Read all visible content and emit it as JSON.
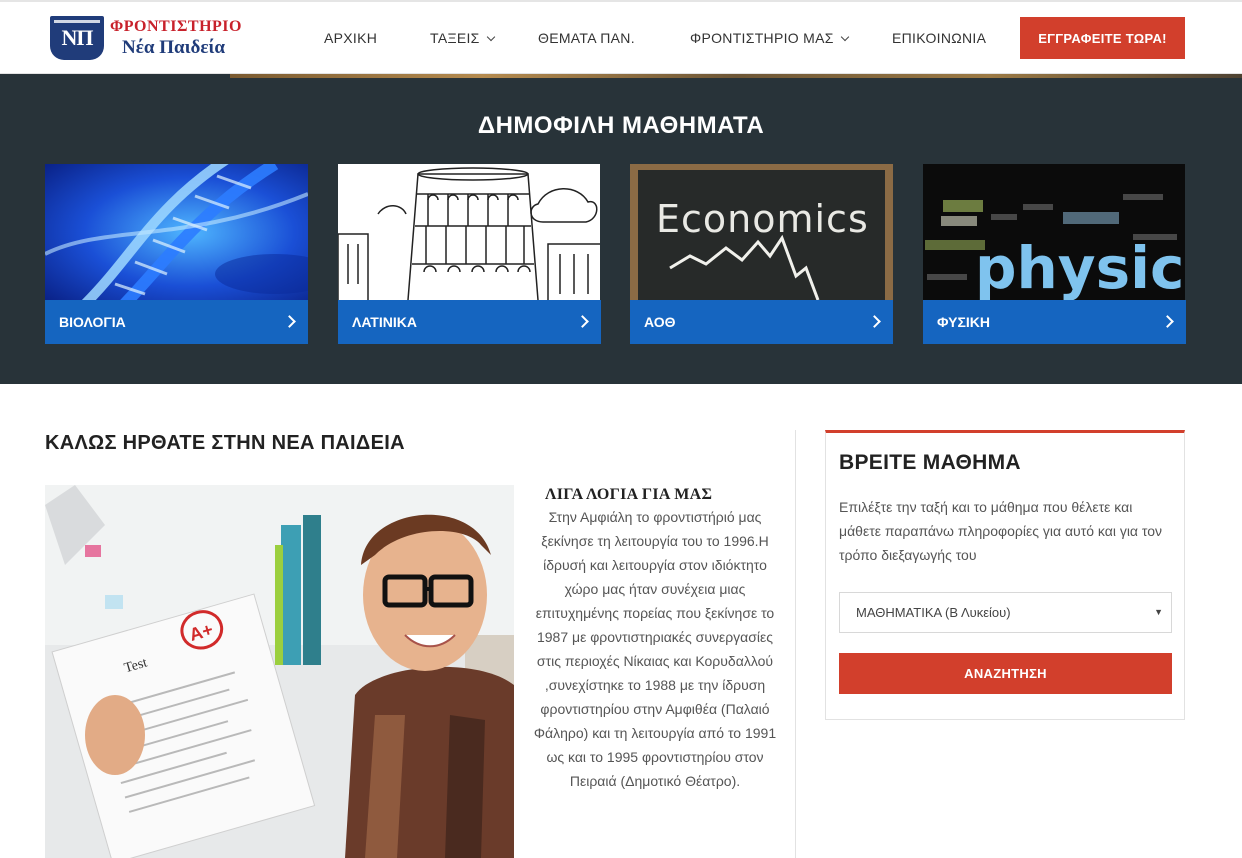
{
  "logo": {
    "line1": "ΦΡΟΝΤΙΣΤΗΡΙΟ",
    "line2": "Νέα Παιδεία",
    "mark": "ΝΠ"
  },
  "nav": {
    "items": [
      {
        "label": "ΑΡΧΙΚΗ",
        "dropdown": false
      },
      {
        "label": "ΤΑΞΕΙΣ",
        "dropdown": true
      },
      {
        "label": "ΘΕΜΑΤΑ ΠΑΝ.",
        "dropdown": false
      },
      {
        "label": "ΦΡΟΝΤΙΣΤΗΡΙΟ ΜΑΣ",
        "dropdown": true
      },
      {
        "label": "ΕΠΙΚΟΙΝΩΝΙΑ",
        "dropdown": false
      }
    ],
    "cta_label": "ΕΓΓΡΑΦΕΙΤΕ ΤΩΡΑ!"
  },
  "popular": {
    "title": "ΔΗΜΟΦΙΛΗ ΜΑΘΗΜΑΤΑ",
    "cards": [
      {
        "label": "ΒΙΟΛΟΓΙΑ"
      },
      {
        "label": "ΛΑΤΙΝΙΚΑ"
      },
      {
        "label": "ΑΟΘ",
        "image_text": "Economics"
      },
      {
        "label": "ΦΥΣΙΚΗ",
        "image_text": "physics"
      }
    ]
  },
  "welcome": {
    "title": "ΚΑΛΩΣ ΗΡΘΑΤΕ ΣΤΗΝ ΝΕΑ ΠΑΙΔΕΙΑ",
    "about_title": "ΛΙΓΑ ΛΟΓΙΑ ΓΙΑ ΜΑΣ",
    "about_text": "Στην Αμφιάλη το φροντιστήριό μας ξεκίνησε τη λειτουργία του το 1996.Η ίδρυσή και λειτουργία στον ιδιόκτητο χώρο μας ήταν συνέχεια μιας επιτυχημένης πορείας που ξεκίνησε το 1987 με φροντιστηριακές συνεργασίες στις περιοχές Νίκαιας και Κορυδαλλού ,συνεχίστηκε το 1988 με την ίδρυση φροντιστηρίου στην Αμφιθέα (Παλαιό Φάληρο) και τη λειτουργία από το 1991 ως και το 1995 φροντιστηρίου στον Πειραιά (Δημοτικό Θέατρο).",
    "photo_paper_text": "Test",
    "photo_grade": "A+"
  },
  "widget": {
    "title": "ΒΡΕΙΤΕ ΜΑΘΗΜΑ",
    "description": "Επιλέξτε την ταξή και το μάθημα που θέλετε και μάθετε παραπάνω πληροφορίες για αυτό και για τον τρόπο διεξαγωγής του",
    "select_value": "ΜΑΘΗΜΑΤΙΚΑ (Β Λυκείου)",
    "button_label": "ΑΝΑΖΗΤΗΣΗ"
  },
  "colors": {
    "accent": "#d23f2c",
    "card_bar": "#1565c0",
    "section_bg": "#283339"
  }
}
